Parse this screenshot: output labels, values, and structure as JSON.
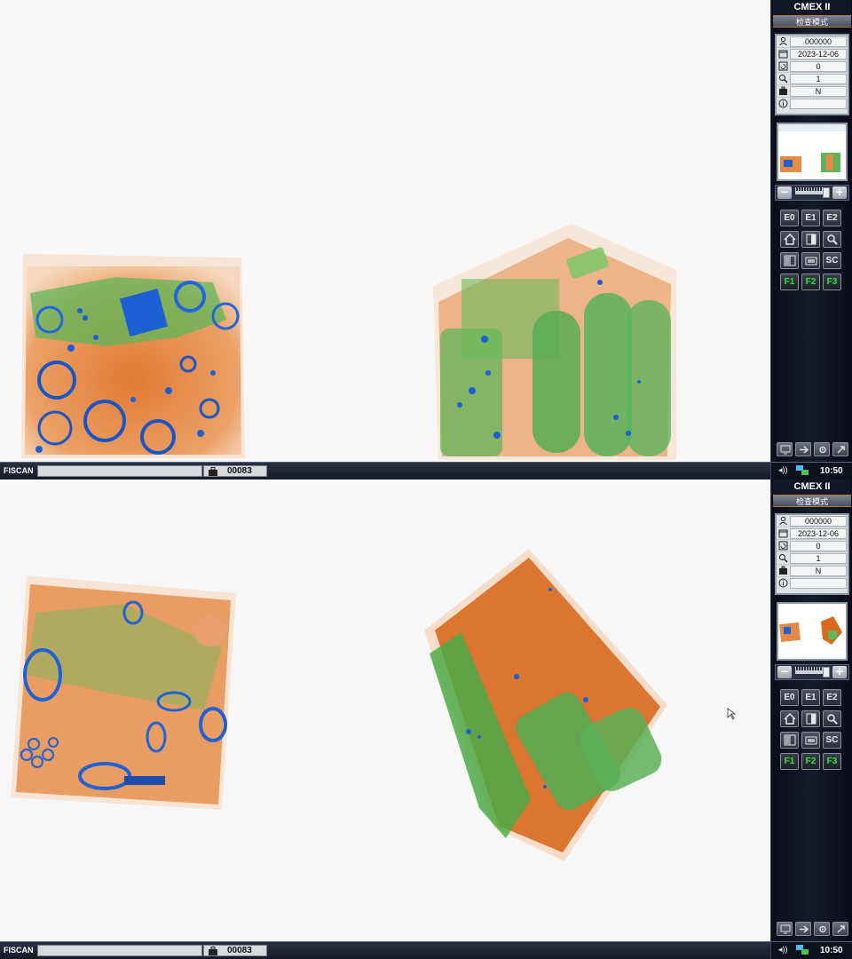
{
  "app": {
    "brand": "CMEX II",
    "mode": "检查模式",
    "status_brand": "FISCAN",
    "bag_counter": "00083",
    "clock": "10:50",
    "sound_icon": "speaker-icon",
    "network_icon": "network-icon"
  },
  "info": {
    "operator_id": "000000",
    "date": "2023-12-06",
    "rotate_count": "0",
    "zoom_level": "1",
    "suspect_flag": "N",
    "note": ""
  },
  "function_buttons": {
    "e0": "E0",
    "e1": "E1",
    "e2": "E2",
    "sc": "SC",
    "f1": "F1",
    "f2": "F2",
    "f3": "F3"
  },
  "colors": {
    "organic": "#e07a2e",
    "mixed": "#4bb04a",
    "metal": "#1e62d6",
    "accent_green": "#2fe23a"
  }
}
